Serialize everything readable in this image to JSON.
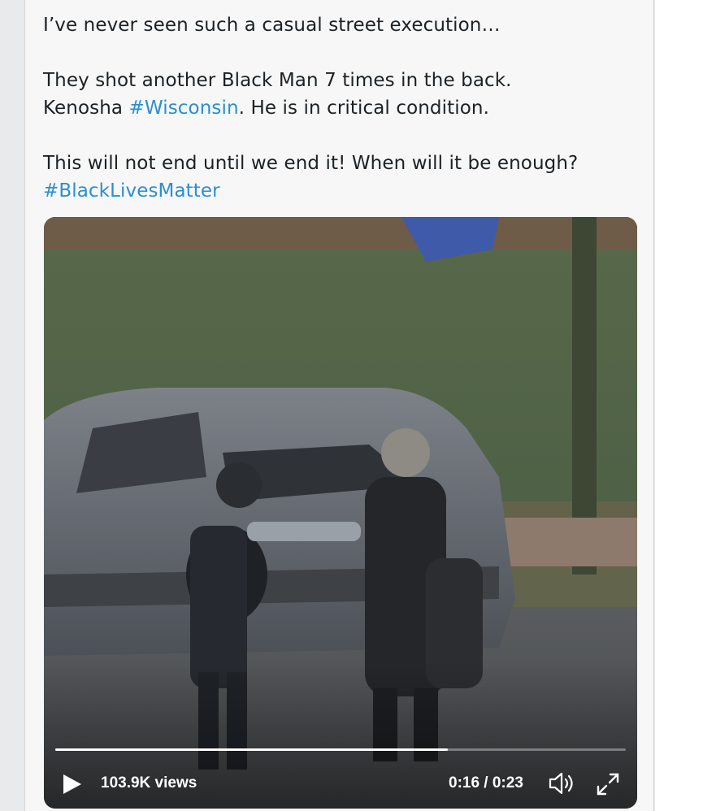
{
  "tweet": {
    "lines": [
      "I’ve never seen such a casual street execution…",
      "They shot another Black Man 7 times in the back.",
      "Kenosha ",
      "#Wisconsin",
      ".  He is in critical condition.",
      "This will not end until we end it! When will it be enough?",
      "#BlackLivesMatter"
    ]
  },
  "video": {
    "views": "103.9K views",
    "time": "0:16 / 0:23",
    "progress": 0.688,
    "icons": {
      "play": "play-icon",
      "volume": "volume-icon",
      "fullscreen": "fullscreen-icon"
    }
  },
  "colors": {
    "hashtag": "#2a8fd0",
    "text": "#1b2125"
  }
}
